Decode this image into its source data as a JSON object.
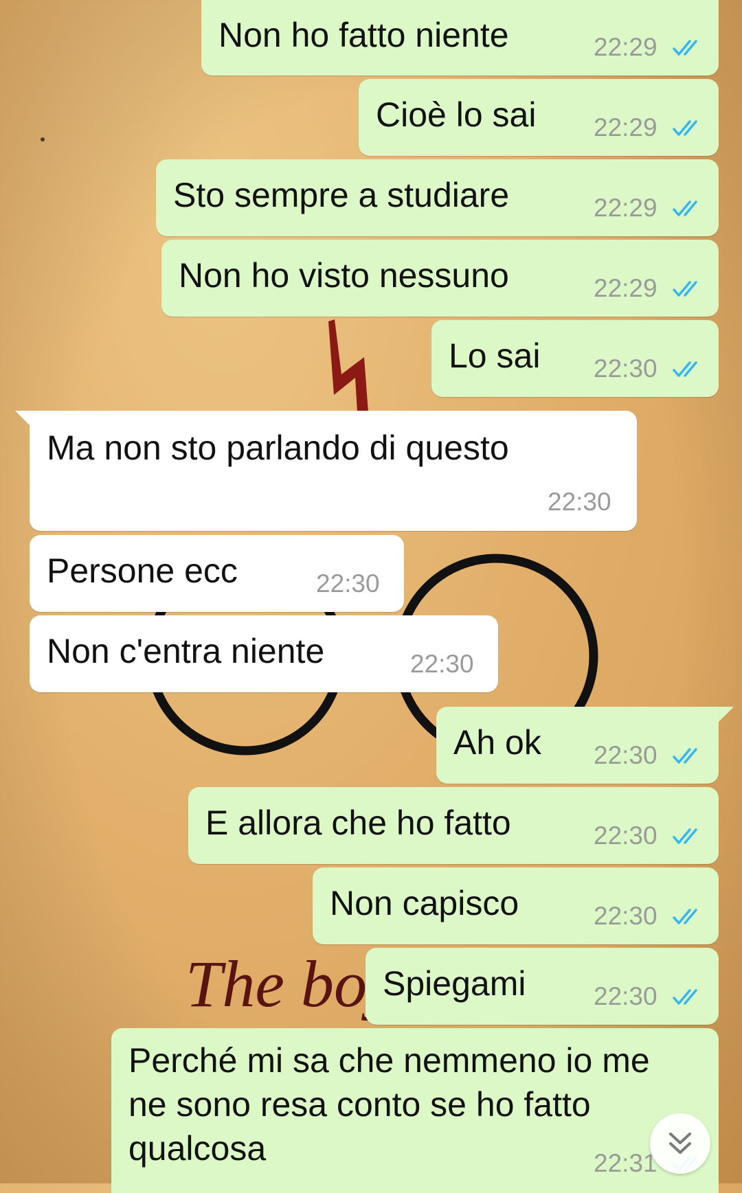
{
  "wallpaper": {
    "script_text": "The boy"
  },
  "colors": {
    "outgoing_bubble": "#dcf8c6",
    "incoming_bubble": "#ffffff",
    "read_tick": "#34b7f1"
  },
  "messages": [
    {
      "dir": "out",
      "text": "Non ho fatto niente",
      "time": "22:29",
      "status": "read"
    },
    {
      "dir": "out",
      "text": "Cioè lo sai",
      "time": "22:29",
      "status": "read"
    },
    {
      "dir": "out",
      "text": "Sto sempre a studiare",
      "time": "22:29",
      "status": "read"
    },
    {
      "dir": "out",
      "text": "Non ho visto nessuno",
      "time": "22:29",
      "status": "read"
    },
    {
      "dir": "out",
      "text": "Lo sai",
      "time": "22:30",
      "status": "read"
    },
    {
      "dir": "in",
      "text": "Ma non sto parlando di questo",
      "time": "22:30"
    },
    {
      "dir": "in",
      "text": "Persone ecc",
      "time": "22:30"
    },
    {
      "dir": "in",
      "text": "Non c'entra niente",
      "time": "22:30"
    },
    {
      "dir": "out",
      "text": "Ah ok",
      "time": "22:30",
      "status": "read"
    },
    {
      "dir": "out",
      "text": "E allora che ho fatto",
      "time": "22:30",
      "status": "read"
    },
    {
      "dir": "out",
      "text": "Non capisco",
      "time": "22:30",
      "status": "read"
    },
    {
      "dir": "out",
      "text": "Spiegami",
      "time": "22:30",
      "status": "read"
    },
    {
      "dir": "out",
      "lines": [
        "Perché mi sa che nemmeno io me",
        "ne sono resa conto se ho fatto",
        "qualcosa"
      ],
      "time": "22:31",
      "status": "read"
    }
  ],
  "scroll_button": {
    "icon": "double-chevron-down-icon"
  }
}
